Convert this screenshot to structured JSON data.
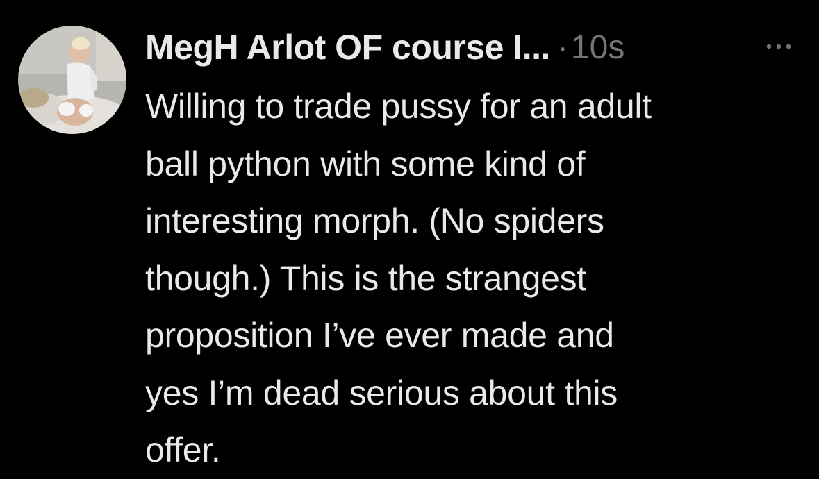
{
  "tweet": {
    "author": {
      "display_name": "MegH Arlot OF course I..."
    },
    "separator": "·",
    "timestamp": "10s",
    "more_icon": "more-horizontal-icon",
    "text": "Willing to trade pussy for an adult\nball python with some kind of\ninteresting morph. (No spiders\nthough.) This is the strangest\nproposition I’ve ever made and\nyes I’m dead serious about this\noffer."
  },
  "colors": {
    "background": "#000000",
    "primary_text": "#e7e9ea",
    "secondary_text": "#71767b"
  }
}
